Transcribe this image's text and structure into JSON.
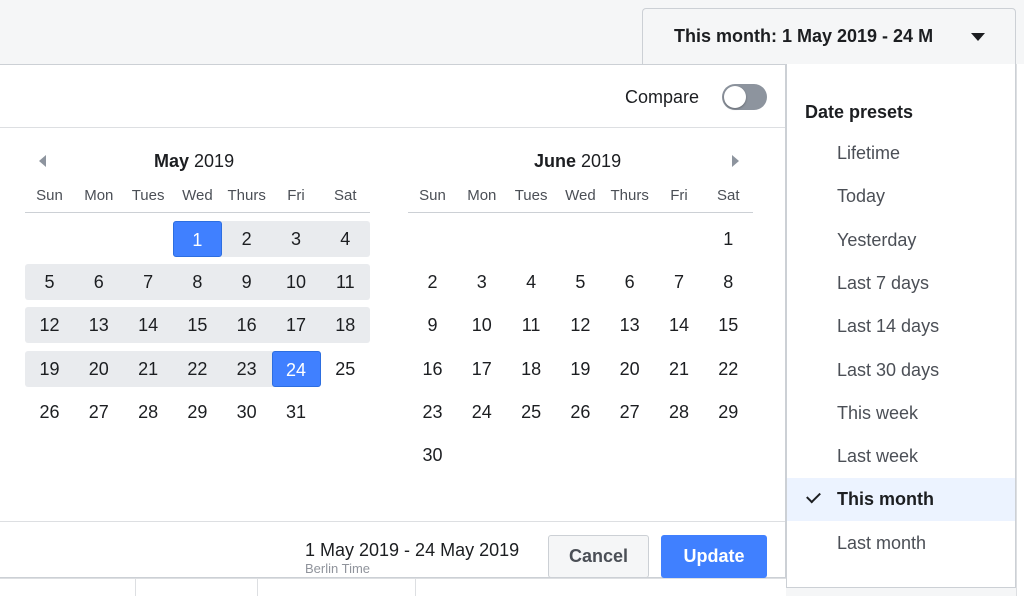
{
  "date_button": {
    "label": "This month: 1 May 2019 - 24 M"
  },
  "compare": {
    "label": "Compare",
    "on": false
  },
  "calendars": [
    {
      "month": "May",
      "year": "2019",
      "weekdays": [
        "Sun",
        "Mon",
        "Tues",
        "Wed",
        "Thurs",
        "Fri",
        "Sat"
      ],
      "weeks": [
        [
          "",
          "",
          "",
          "1",
          "2",
          "3",
          "4"
        ],
        [
          "5",
          "6",
          "7",
          "8",
          "9",
          "10",
          "11"
        ],
        [
          "12",
          "13",
          "14",
          "15",
          "16",
          "17",
          "18"
        ],
        [
          "19",
          "20",
          "21",
          "22",
          "23",
          "24",
          "25"
        ],
        [
          "26",
          "27",
          "28",
          "29",
          "30",
          "31",
          ""
        ]
      ],
      "selected": [
        "1",
        "24"
      ]
    },
    {
      "month": "June",
      "year": "2019",
      "weekdays": [
        "Sun",
        "Mon",
        "Tues",
        "Wed",
        "Thurs",
        "Fri",
        "Sat"
      ],
      "weeks": [
        [
          "",
          "",
          "",
          "",
          "",
          "",
          "1"
        ],
        [
          "2",
          "3",
          "4",
          "5",
          "6",
          "7",
          "8"
        ],
        [
          "9",
          "10",
          "11",
          "12",
          "13",
          "14",
          "15"
        ],
        [
          "16",
          "17",
          "18",
          "19",
          "20",
          "21",
          "22"
        ],
        [
          "23",
          "24",
          "25",
          "26",
          "27",
          "28",
          "29"
        ],
        [
          "30",
          "",
          "",
          "",
          "",
          "",
          ""
        ]
      ],
      "selected": []
    }
  ],
  "footer": {
    "range": "1 May 2019 - 24 May 2019",
    "timezone": "Berlin Time",
    "cancel_label": "Cancel",
    "update_label": "Update"
  },
  "presets": {
    "title": "Date presets",
    "items": [
      {
        "label": "Lifetime",
        "active": false
      },
      {
        "label": "Today",
        "active": false
      },
      {
        "label": "Yesterday",
        "active": false
      },
      {
        "label": "Last 7 days",
        "active": false
      },
      {
        "label": "Last 14 days",
        "active": false
      },
      {
        "label": "Last 30 days",
        "active": false
      },
      {
        "label": "This week",
        "active": false
      },
      {
        "label": "Last week",
        "active": false
      },
      {
        "label": "This month",
        "active": true
      },
      {
        "label": "Last month",
        "active": false
      }
    ]
  },
  "colors": {
    "accent": "#4080ff",
    "range_band": "#e9ebee",
    "active_preset_bg": "#ecf3ff"
  },
  "icons": {
    "dropdown": "caret-down-icon",
    "prev": "chevron-left-icon",
    "next": "chevron-right-icon",
    "checked": "checkmark-icon"
  }
}
